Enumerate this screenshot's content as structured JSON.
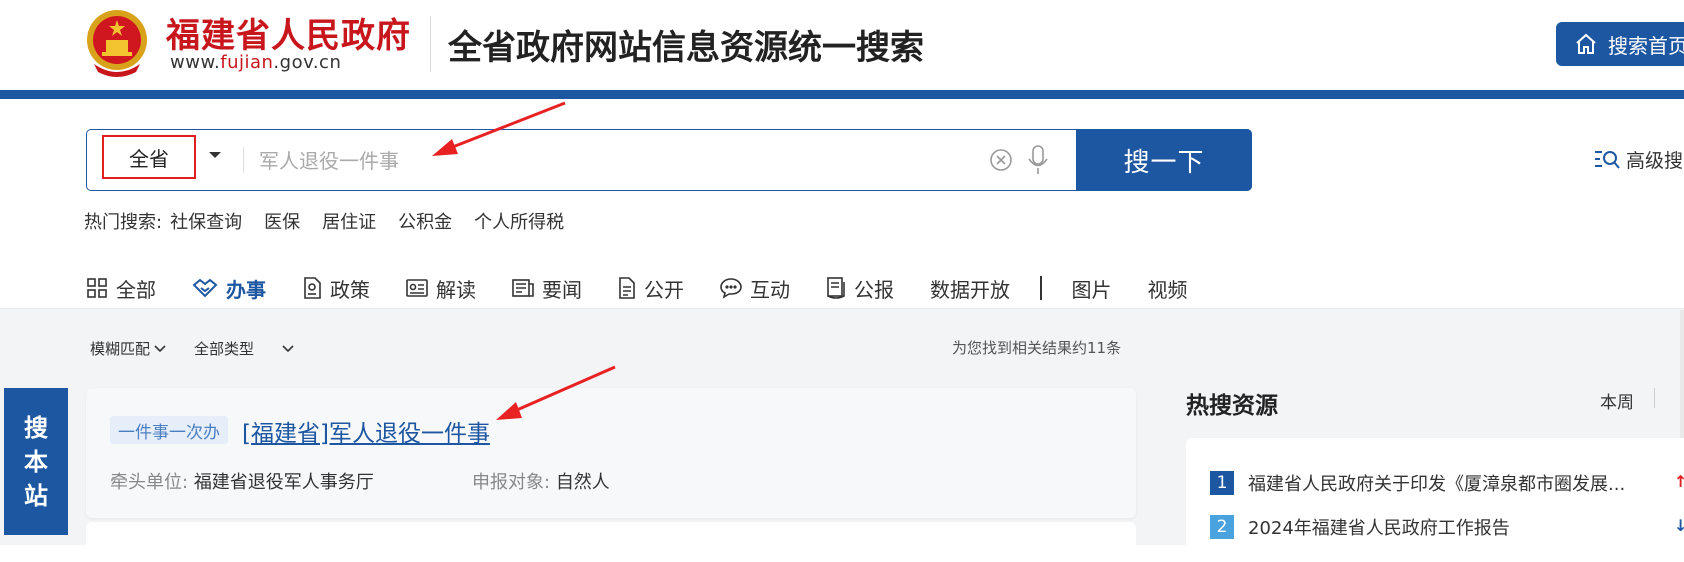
{
  "header": {
    "logo_name": "福建省人民政府",
    "logo_url_pre": "www.",
    "logo_url_mid": "fujian",
    "logo_url_post": ".gov.cn",
    "site_title": "全省政府网站信息资源统一搜索",
    "home_button": "搜索首页"
  },
  "search": {
    "scope": "全省",
    "placeholder": "军人退役一件事",
    "button": "搜一下",
    "advanced": "高级搜索"
  },
  "hot_search": {
    "label": "热门搜索:",
    "items": [
      "社保查询",
      "医保",
      "居住证",
      "公积金",
      "个人所得税"
    ]
  },
  "tabs": [
    "全部",
    "办事",
    "政策",
    "解读",
    "要闻",
    "公开",
    "互动",
    "公报",
    "数据开放",
    "图片",
    "视频"
  ],
  "filters": {
    "match": "模糊匹配",
    "type": "全部类型",
    "result_count": "为您找到相关结果约11条"
  },
  "side_button": [
    "搜",
    "本",
    "站"
  ],
  "result": {
    "tag": "一件事一次办",
    "title": "[福建省]军人退役一件事",
    "dept_label": "牵头单位:",
    "dept_value": "福建省退役军人事务厅",
    "target_label": "申报对象:",
    "target_value": "自然人"
  },
  "hot_resources": {
    "title": "热搜资源",
    "period": "本周",
    "items": [
      {
        "rank": "1",
        "text": "福建省人民政府关于印发《厦漳泉都市圈发展...",
        "trend": "↑"
      },
      {
        "rank": "2",
        "text": "2024年福建省人民政府工作报告",
        "trend": "↓"
      }
    ]
  },
  "colors": {
    "brand_blue": "#1d57a1",
    "brand_red": "#c8161d",
    "annotation_red": "#e02020"
  }
}
